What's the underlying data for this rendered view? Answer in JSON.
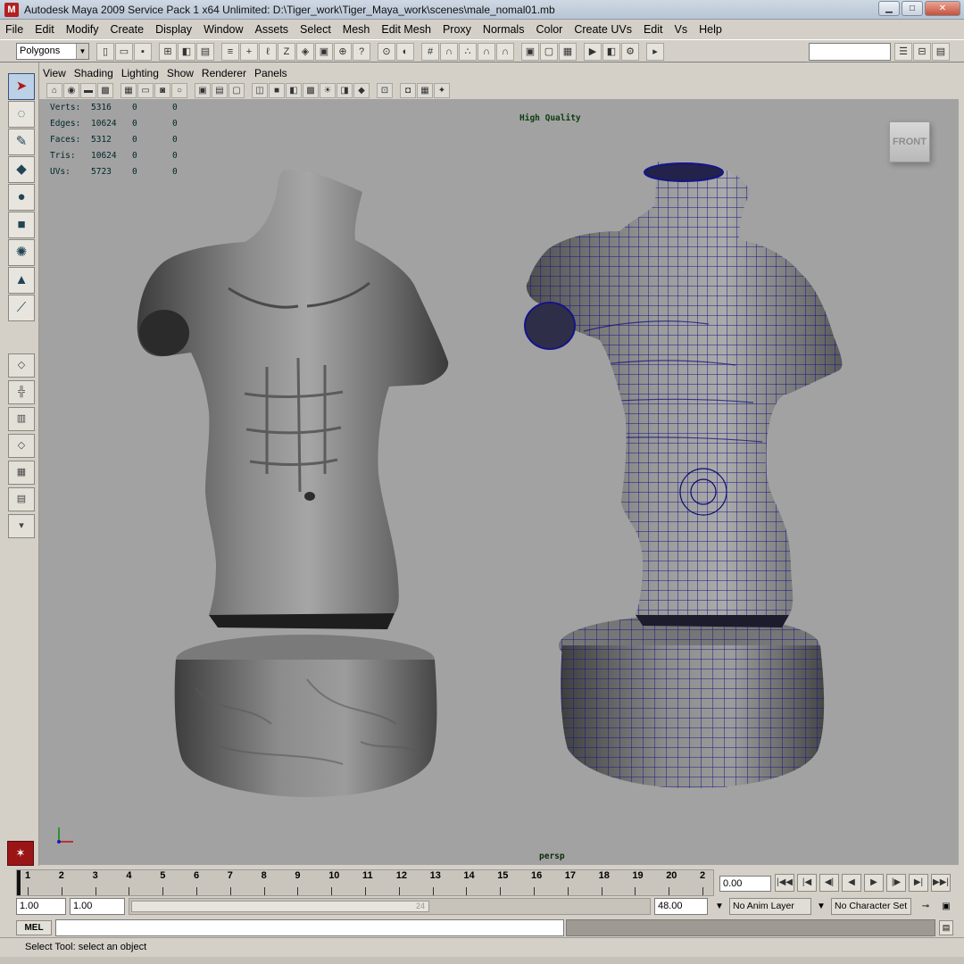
{
  "window": {
    "title": "Autodesk Maya 2009 Service Pack 1 x64 Unlimited: D:\\Tiger_work\\Tiger_Maya_work\\scenes\\male_nomal01.mb",
    "app_icon": "M"
  },
  "menubar": [
    "File",
    "Edit",
    "Modify",
    "Create",
    "Display",
    "Window",
    "Assets",
    "Select",
    "Mesh",
    "Edit Mesh",
    "Proxy",
    "Normals",
    "Color",
    "Create UVs",
    "Edit",
    "Vs",
    "Help"
  ],
  "toolbar": {
    "mode": "Polygons",
    "icons": [
      "new-scene-icon",
      "open-scene-icon",
      "save-scene-icon",
      "select-hierarchy-icon",
      "select-object-icon",
      "select-component-icon",
      "snap-grid-icon",
      "snap-curve-icon",
      "snap-point-icon",
      "snap-plane-icon",
      "render-icon",
      "ipr-icon",
      "render-settings-icon"
    ]
  },
  "viewport_menu": [
    "View",
    "Shading",
    "Lighting",
    "Show",
    "Renderer",
    "Panels"
  ],
  "hud": {
    "rows": [
      {
        "label": "Verts:",
        "value": "5316",
        "a": "0",
        "b": "0"
      },
      {
        "label": "Edges:",
        "value": "10624",
        "a": "0",
        "b": "0"
      },
      {
        "label": "Faces:",
        "value": "5312",
        "a": "0",
        "b": "0"
      },
      {
        "label": "Tris:",
        "value": "10624",
        "a": "0",
        "b": "0"
      },
      {
        "label": "UVs:",
        "value": "5723",
        "a": "0",
        "b": "0"
      }
    ],
    "quality": "High Quality",
    "viewcube_face": "FRONT",
    "camera": "persp"
  },
  "timeline": {
    "ticks": [
      "1",
      "2",
      "3",
      "4",
      "5",
      "6",
      "7",
      "8",
      "9",
      "10",
      "11",
      "12",
      "13",
      "14",
      "15",
      "16",
      "17",
      "18",
      "19",
      "20",
      "2"
    ],
    "current_frame": "0.00"
  },
  "range": {
    "start": "1.00",
    "playback_start": "1.00",
    "playback_end_handle": "24",
    "end": "48.00",
    "anim_layer": "No Anim Layer",
    "character_set": "No Character Set"
  },
  "command": {
    "mel_label": "MEL"
  },
  "help_line": "Select Tool: select an object",
  "colors": {
    "viewport_bg": "#a2a2a2",
    "wireframe": "#10108c",
    "ui_bg": "#d4d0c8"
  }
}
